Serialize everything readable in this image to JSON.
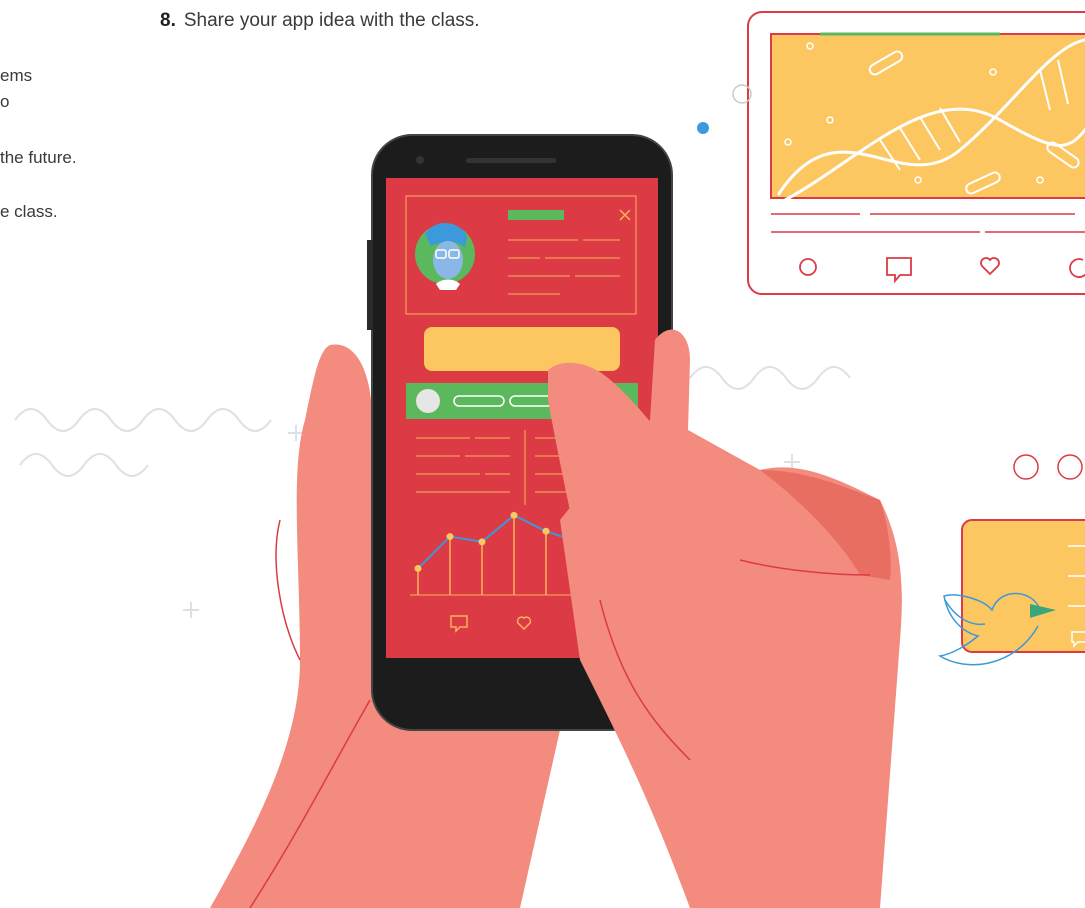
{
  "instructions": {
    "partial_lines": [
      "ems",
      "o",
      "the future.",
      "e class."
    ],
    "step": {
      "number": "8.",
      "text": "Share your app idea with the class."
    }
  },
  "colors": {
    "accent_red": "#dc3a45",
    "yellow": "#fcc660",
    "green": "#5cb85c",
    "skin": "#f38b7e",
    "skin_dark": "#e86e62",
    "blue": "#3c99dc",
    "phone": "#1c1c1c"
  },
  "chart_data": {
    "type": "line",
    "x": [
      1,
      2,
      3,
      4,
      5,
      6,
      7
    ],
    "values": [
      25,
      55,
      50,
      75,
      60,
      50,
      60
    ],
    "title": "",
    "xlabel": "",
    "ylabel": "",
    "ylim": [
      0,
      80
    ]
  },
  "icons": [
    "close-icon",
    "comment-icon",
    "heart-icon",
    "share-icon",
    "circle-icon",
    "bird-icon"
  ]
}
